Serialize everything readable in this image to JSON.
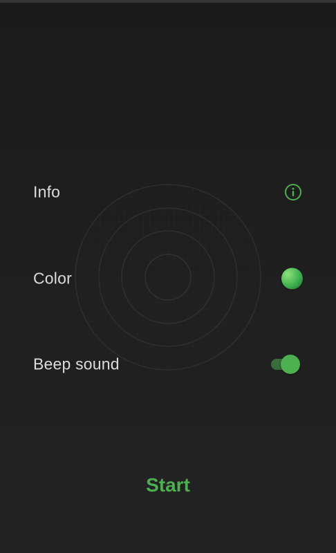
{
  "settings": {
    "info": {
      "label": "Info",
      "icon": "info-icon"
    },
    "color": {
      "label": "Color",
      "value_color": "#3fb24f"
    },
    "beep": {
      "label": "Beep sound",
      "enabled": true
    }
  },
  "start_button": {
    "label": "Start"
  },
  "colors": {
    "accent": "#4caf50",
    "background": "#1e1e1e",
    "text": "#dcdcdc"
  }
}
